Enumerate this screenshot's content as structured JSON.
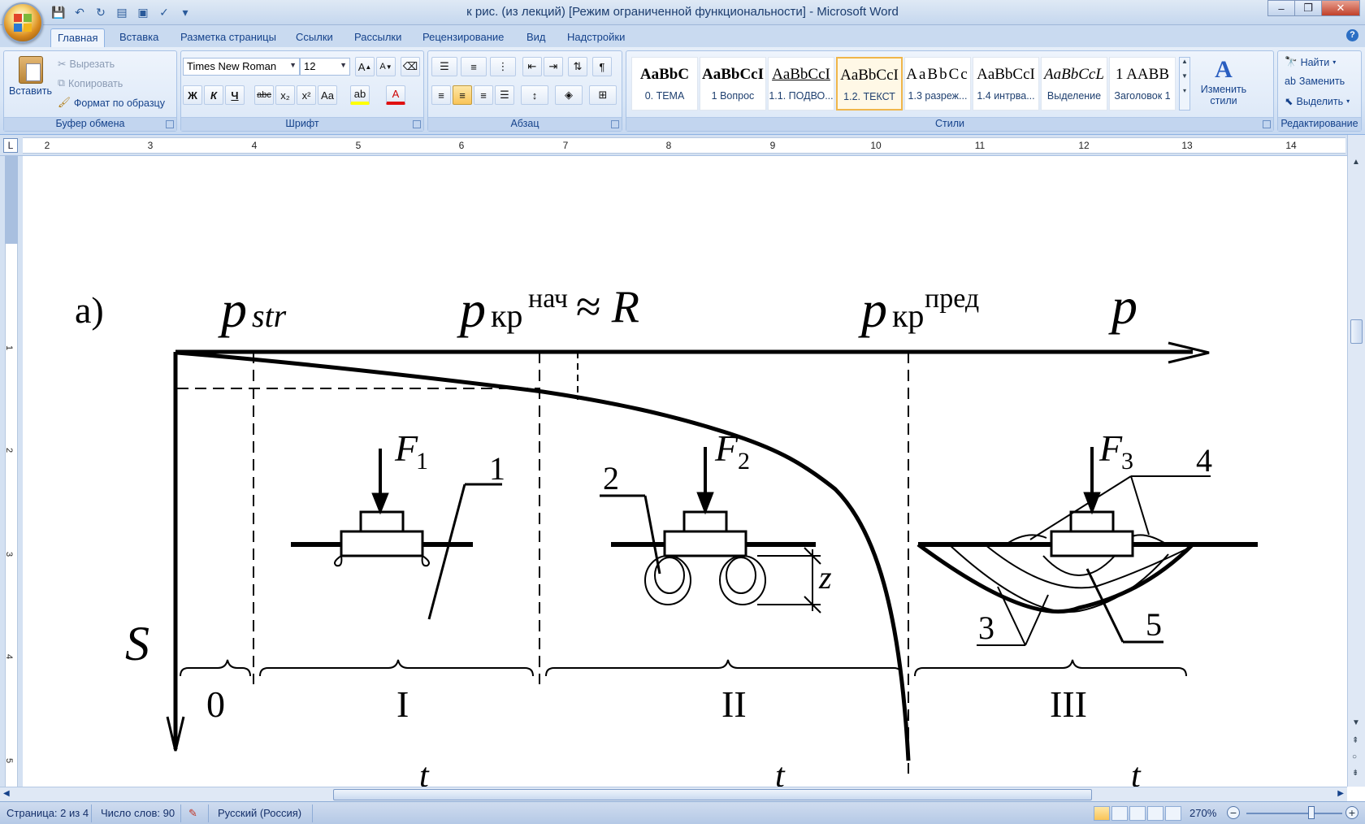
{
  "window": {
    "title": "к рис. (из лекций) [Режим ограниченной функциональности] - Microsoft Word",
    "minimize": "–",
    "restore": "❐",
    "close": "✕"
  },
  "tabs": [
    "Главная",
    "Вставка",
    "Разметка страницы",
    "Ссылки",
    "Рассылки",
    "Рецензирование",
    "Вид",
    "Надстройки"
  ],
  "clipboard": {
    "paste": "Вставить",
    "cut": "Вырезать",
    "copy": "Копировать",
    "format_painter": "Формат по образцу",
    "label": "Буфер обмена"
  },
  "font": {
    "name": "Times New Roman",
    "size": "12",
    "grow": "A",
    "shrink": "A",
    "bold": "Ж",
    "italic": "К",
    "underline": "Ч",
    "strike": "abc",
    "subscript": "x₂",
    "superscript": "x²",
    "case": "Aa",
    "highlight": "ab",
    "color": "A",
    "label": "Шрифт"
  },
  "paragraph": {
    "label": "Абзац",
    "pilcrow": "¶"
  },
  "styles": {
    "label": "Стили",
    "items": [
      {
        "sample": "AaBbC",
        "name": "0. ТЕМА"
      },
      {
        "sample": "AaBbCcI",
        "name": "1 Вопрос"
      },
      {
        "sample": "AaBbCcI",
        "name": "1.1. ПОДВО..."
      },
      {
        "sample": "AaBbCcI",
        "name": "1.2. ТЕКСТ"
      },
      {
        "sample": "AaBbCc",
        "name": "1.3 разреж..."
      },
      {
        "sample": "AaBbCcI",
        "name": "1.4  интрва..."
      },
      {
        "sample": "AaBbCcL",
        "name": "Выделение"
      },
      {
        "sample": "1  AABB",
        "name": "Заголовок 1"
      }
    ],
    "change_styles": "Изменить стили"
  },
  "editing": {
    "label": "Редактирование",
    "find": "Найти",
    "replace": "Заменить",
    "select": "Выделить"
  },
  "ruler": {
    "corner": "L",
    "numbers": [
      "2",
      "3",
      "4",
      "5",
      "6",
      "7",
      "8",
      "9",
      "10",
      "11",
      "12",
      "13",
      "14"
    ]
  },
  "vruler": {
    "numbers": [
      "1",
      "2",
      "3",
      "4",
      "5"
    ]
  },
  "figure": {
    "label_a": "а)",
    "p_str_base": "p",
    "p_str_sub": "str",
    "p_kr_base": "p",
    "p_kr_sub": "кр",
    "p_kr_nach_sup": "нач",
    "approx_r": "≈ R",
    "p_kr2_base": "p",
    "p_kr2_sub": "кр",
    "p_kr_pred_sup": "пред",
    "p_axis": "p",
    "s_axis": "S",
    "f1": "F",
    "f1_sub": "1",
    "f2": "F",
    "f2_sub": "2",
    "f3": "F",
    "f3_sub": "3",
    "n1": "1",
    "n2": "2",
    "n3": "3",
    "n4": "4",
    "n5": "5",
    "z": "z",
    "phase0": "0",
    "phase1": "I",
    "phase2": "II",
    "phase3": "III",
    "t": "t"
  },
  "status": {
    "page": "Страница: 2 из 4",
    "words": "Число слов: 90",
    "language": "Русский (Россия)",
    "zoom": "270%"
  }
}
